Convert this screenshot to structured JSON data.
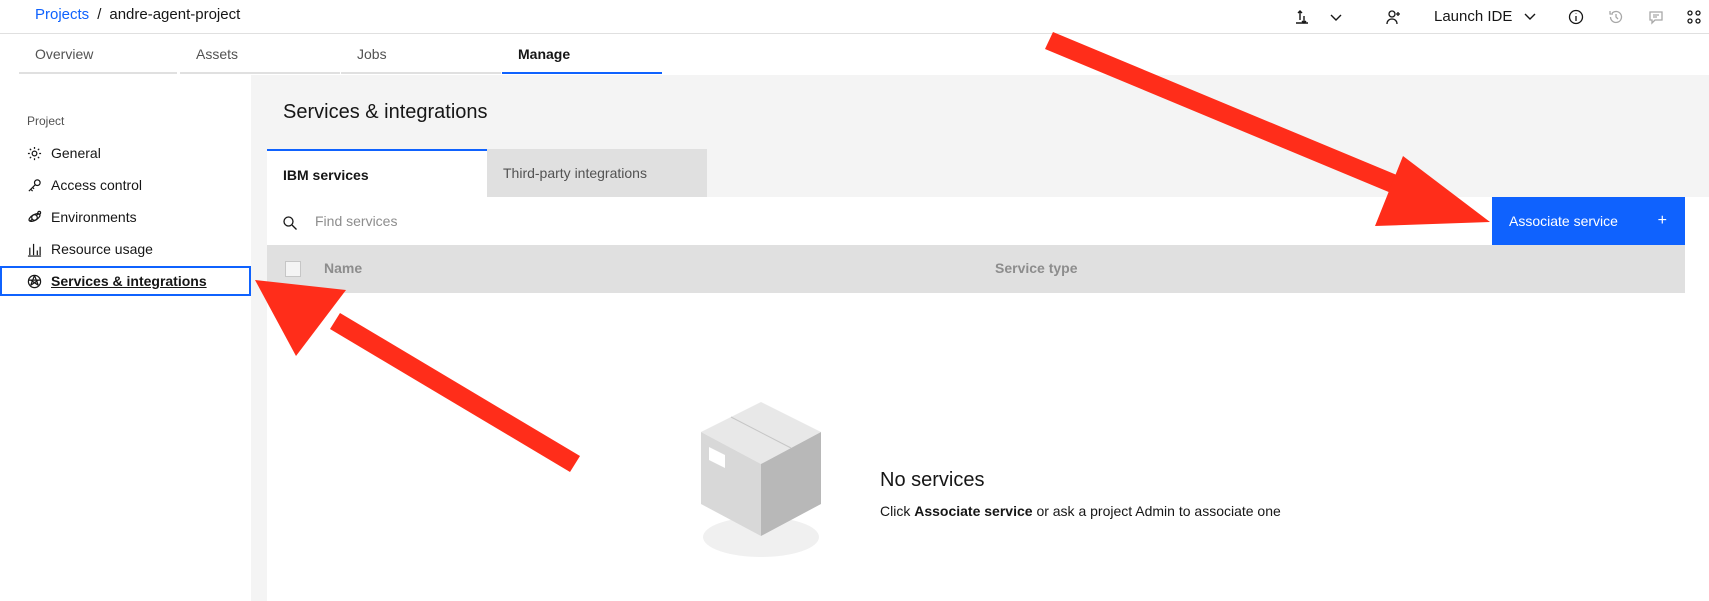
{
  "breadcrumb": {
    "root": "Projects",
    "separator": "/",
    "current": "andre-agent-project"
  },
  "header": {
    "launch_ide": "Launch IDE"
  },
  "tabs": [
    "Overview",
    "Assets",
    "Jobs",
    "Manage"
  ],
  "sidebar": {
    "group": "Project",
    "items": [
      {
        "label": "General",
        "icon": "gear-icon"
      },
      {
        "label": "Access control",
        "icon": "key-icon"
      },
      {
        "label": "Environments",
        "icon": "environment-icon"
      },
      {
        "label": "Resource usage",
        "icon": "chart-icon"
      },
      {
        "label": "Services & integrations",
        "icon": "services-icon"
      }
    ]
  },
  "main": {
    "title": "Services & integrations",
    "tabs": [
      "IBM services",
      "Third-party integrations"
    ],
    "search_placeholder": "Find services",
    "associate_button": "Associate service",
    "associate_icon": "+",
    "table": {
      "columns": [
        "Name",
        "Service type"
      ]
    },
    "empty": {
      "title": "No services",
      "desc_prefix": "Click",
      "desc_bold": "Associate service",
      "desc_suffix": "or ask a project Admin to associate one"
    }
  },
  "colors": {
    "accent": "#0f62fe",
    "arrow": "#ff2d1a"
  }
}
